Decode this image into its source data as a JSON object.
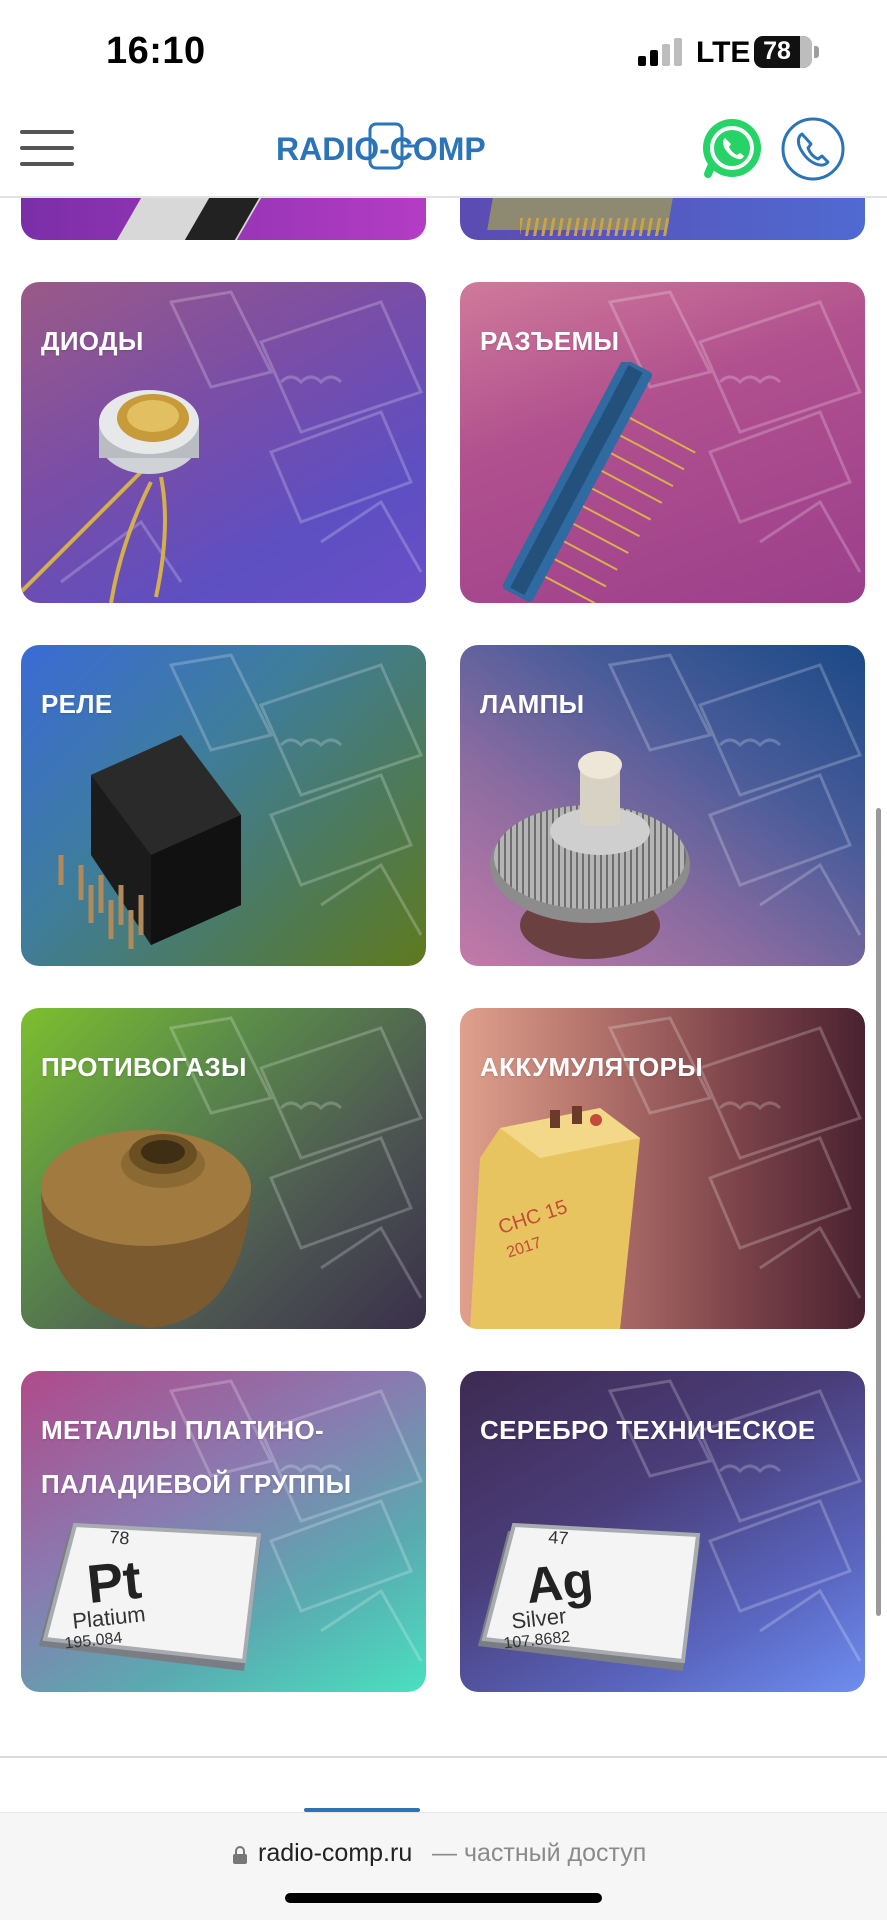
{
  "status_bar": {
    "time": "16:10",
    "network": "LTE",
    "battery": "78",
    "icons": [
      "signal-icon",
      "battery-icon"
    ]
  },
  "header": {
    "logo_text": "RADIO-COMP",
    "icons": [
      "menu-icon",
      "whatsapp-icon",
      "phone-icon"
    ],
    "colors": {
      "brand": "#2b74b8",
      "whatsapp": "#25d366"
    }
  },
  "categories": [
    {
      "label": "ДИОДЫ"
    },
    {
      "label": "РАЗЪЕМЫ"
    },
    {
      "label": "РЕЛЕ"
    },
    {
      "label": "ЛАМПЫ"
    },
    {
      "label": "ПРОТИВОГАЗЫ"
    },
    {
      "label": "АККУМУЛЯТОРЫ"
    },
    {
      "label": "МЕТАЛЛЫ ПЛАТИНО-ПАЛАДИЕВОЙ ГРУППЫ"
    },
    {
      "label": "СЕРЕБРО ТЕХНИЧЕСКОЕ"
    }
  ],
  "elements": {
    "pt": {
      "number": "78",
      "symbol": "Pt",
      "name": "Platium",
      "mass": "195.084"
    },
    "ag": {
      "number": "47",
      "symbol": "Ag",
      "name": "Silver",
      "mass": "107.8682"
    }
  },
  "battery_print": {
    "line1": "СНС 15",
    "line2": "2017"
  },
  "address_bar": {
    "url": "radio-comp.ru",
    "suffix": "— частный доступ"
  }
}
